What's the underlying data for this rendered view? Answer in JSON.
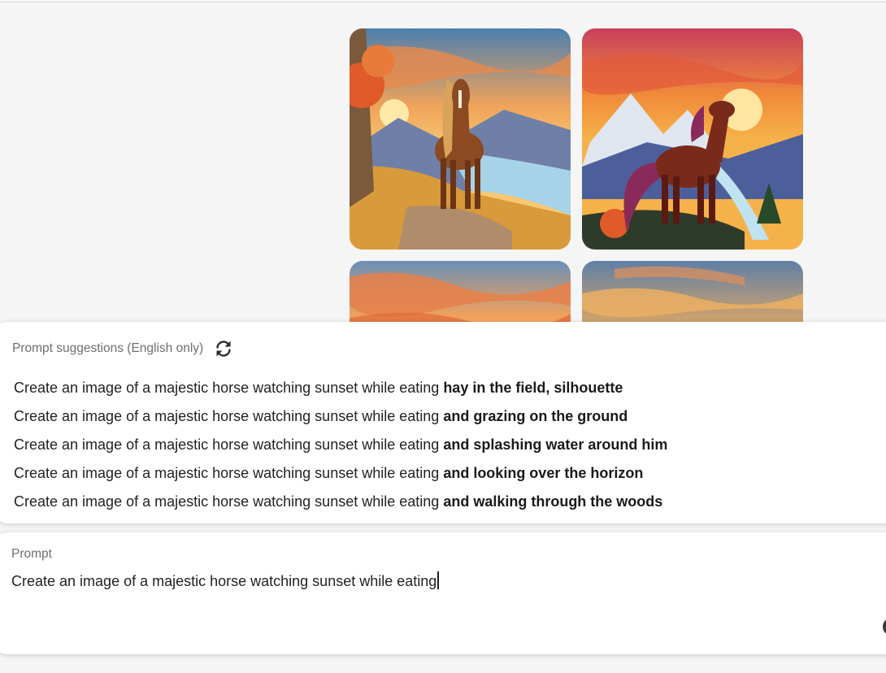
{
  "suggestions": {
    "title": "Prompt suggestions (English only)",
    "refresh_icon": "refresh-icon",
    "prefix": "Create an image of a majestic horse watching sunset while eating",
    "items": [
      {
        "prefix": "Create an image of a majestic horse watching sunset while eating",
        "completion": "hay in the field, silhouette"
      },
      {
        "prefix": "Create an image of a majestic horse watching sunset while eating",
        "completion": "and grazing on the ground"
      },
      {
        "prefix": "Create an image of a majestic horse watching sunset while eating",
        "completion": "and splashing water around him"
      },
      {
        "prefix": "Create an image of a majestic horse watching sunset while eating",
        "completion": "and looking over the horizon"
      },
      {
        "prefix": "Create an image of a majestic horse watching sunset while eating",
        "completion": "and walking through the woods"
      }
    ]
  },
  "prompt": {
    "label": "Prompt",
    "value": "Create an image of a majestic horse watching sunset while eating"
  },
  "gallery": {
    "images": [
      {
        "name": "horse-sunset-image-1",
        "description_icon": "image"
      },
      {
        "name": "horse-sunset-image-2",
        "description_icon": "image"
      },
      {
        "name": "horse-sunset-image-3",
        "description_icon": "image"
      },
      {
        "name": "horse-sunset-image-4",
        "description_icon": "image"
      }
    ]
  },
  "colors": {
    "background": "#f5f5f5",
    "panel": "#ffffff",
    "text": "#222222",
    "muted": "#6e6e6e"
  }
}
